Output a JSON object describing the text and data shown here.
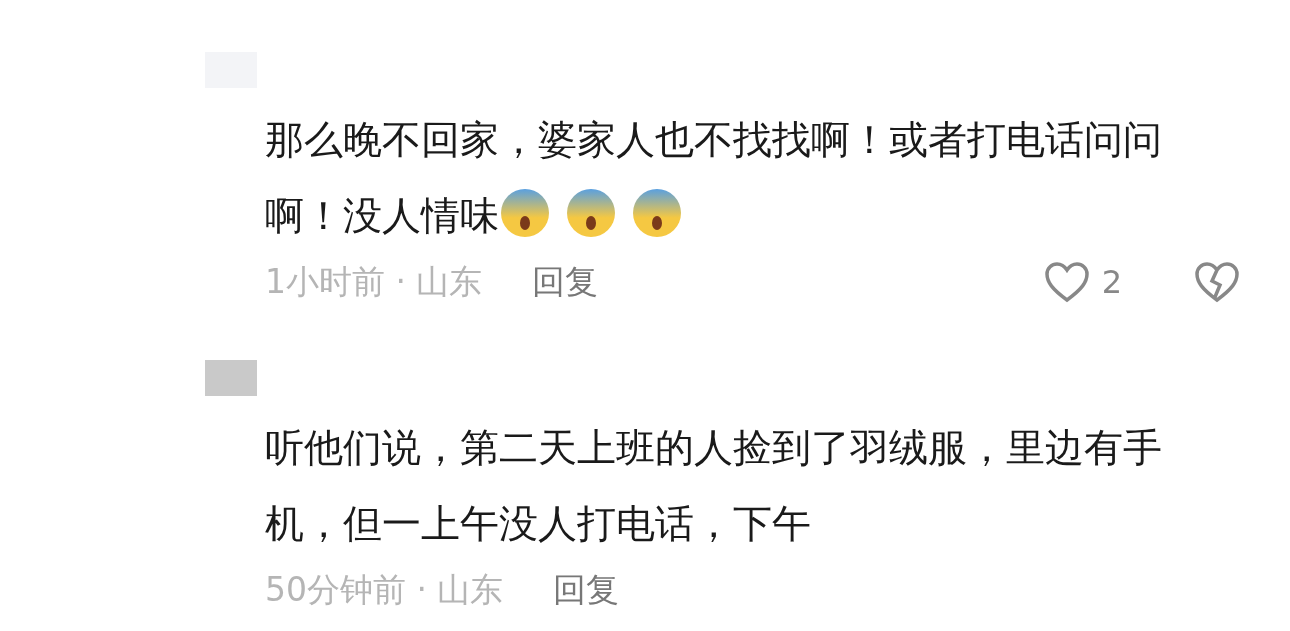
{
  "comments": [
    {
      "color": "#f3f4f7",
      "text": "那么晚不回家，婆家人也不找找啊！或者打电话问问啊！没人情味",
      "emojis": [
        {
          "kind": "scream"
        },
        {
          "kind": "scream"
        },
        {
          "kind": "scream"
        }
      ],
      "time": "1小时前 · 山东",
      "reply": "回复",
      "likes": "2",
      "liked": false
    },
    {
      "color": "#c9c9c9",
      "text": "听他们说，第二天上班的人捡到了羽绒服，里边有手机，但一上午没人打电话，下午",
      "time": "50分钟前 · 山东",
      "reply": "回复"
    }
  ]
}
